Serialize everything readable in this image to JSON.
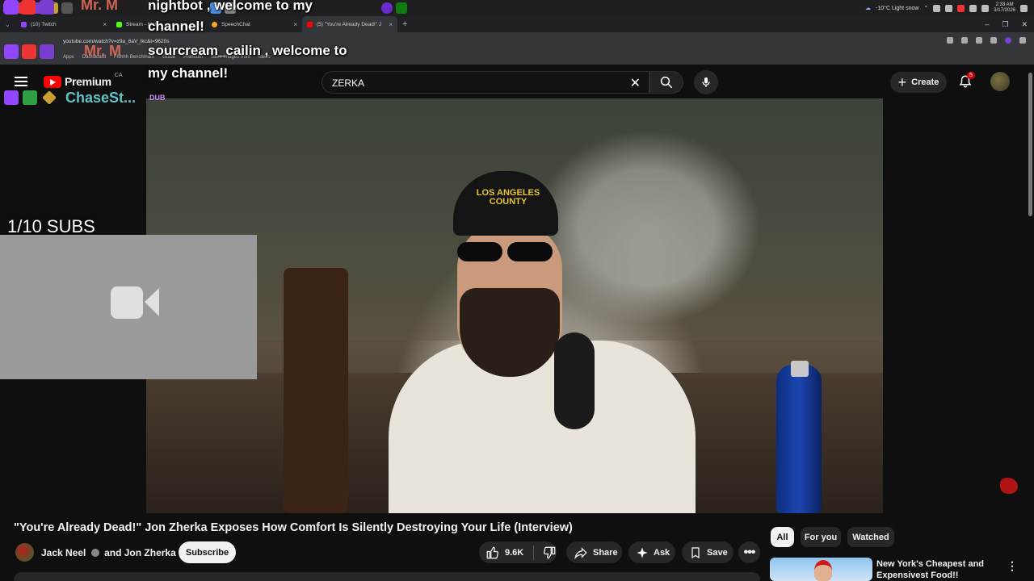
{
  "stream_overlay": {
    "chat_messages": [
      {
        "text": "nightbot , welcome to my"
      },
      {
        "text": "channel!"
      },
      {
        "text": "sourcream_cailin , welcome to"
      },
      {
        "text": "my channel!"
      }
    ],
    "chaser_name": "ChaseSt...",
    "dub_label": "DUB",
    "sub_goal": "1/10 SUBS",
    "mr_m_label": "Mr. M"
  },
  "taskbar": {
    "weather": "-10°C  Light snow",
    "time": "2:33 AM",
    "date": "3/17/2026"
  },
  "browser": {
    "tabs": [
      {
        "label": "(10) Twitch",
        "favicon_color": "#9146ff",
        "active": false
      },
      {
        "label": "Stream - Kick",
        "favicon_color": "#53fc18",
        "active": false
      },
      {
        "label": "SpeechChat",
        "favicon_color": "#f5a623",
        "active": false
      },
      {
        "label": "(5) \"You're Already Dead!\" J",
        "favicon_color": "#ff0000",
        "active": true
      }
    ],
    "url": "youtube.com/watch?v=z9a_6aV_lkc&t=9620s",
    "bookmarks": [
      "Apps",
      "Dashboard",
      "Fishhh Benchmark",
      "Guide",
      "Premium",
      "Save Images from",
      "Ideas"
    ]
  },
  "youtube": {
    "logo_text": "Premium",
    "country_code": "CA",
    "search_value": "ZERKA",
    "create_label": "Create",
    "notification_count": "5",
    "video": {
      "hat_text": "LOS ANGELES COUNTY"
    },
    "video_title": "\"You're Already Dead!\" Jon Zherka Exposes How Comfort Is Silently Destroying Your Life (Interview)",
    "channel_name_1": "Jack Neel",
    "channel_name_2": "and Jon Zherka",
    "subscribe_label": "Subscribe",
    "like_count": "9.6K",
    "share_label": "Share",
    "ask_label": "Ask",
    "save_label": "Save",
    "chips": [
      {
        "label": "All",
        "active": true
      },
      {
        "label": "For you",
        "active": false
      },
      {
        "label": "Watched",
        "active": false
      }
    ],
    "recommendation": {
      "title": "New York's Cheapest and Expensivest Food!!"
    }
  },
  "colors": {
    "youtube_red": "#ff0000",
    "accent_teal": "#5ec4c8",
    "dub_purple": "#c78ff0"
  }
}
